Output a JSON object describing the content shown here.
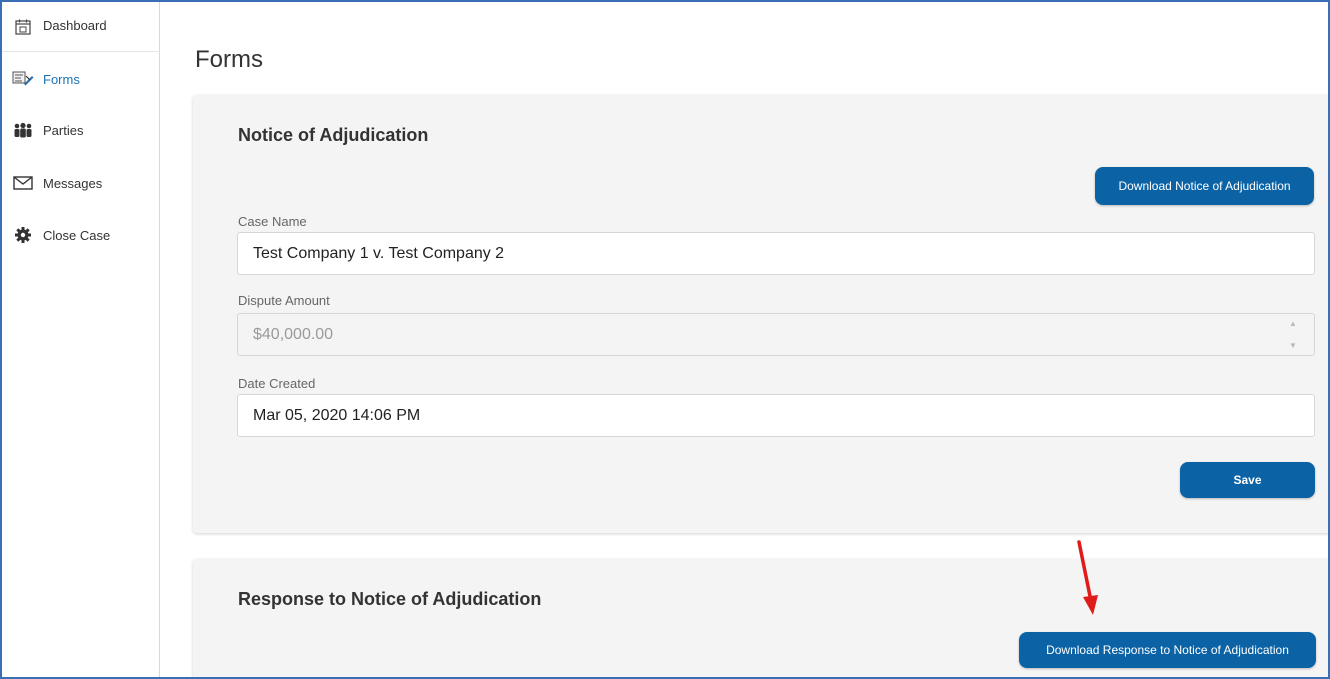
{
  "sidebar": {
    "items": [
      {
        "label": "Dashboard",
        "icon": "calendar-icon",
        "active": false
      },
      {
        "label": "Forms",
        "icon": "forms-icon",
        "active": true
      },
      {
        "label": "Parties",
        "icon": "people-icon",
        "active": false
      },
      {
        "label": "Messages",
        "icon": "envelope-icon",
        "active": false
      },
      {
        "label": "Close Case",
        "icon": "gear-icon",
        "active": false
      }
    ]
  },
  "main": {
    "title": "Forms",
    "notice": {
      "title": "Notice of Adjudication",
      "download_label": "Download Notice of Adjudication",
      "case_name_label": "Case Name",
      "case_name_value": "Test Company 1 v. Test Company 2",
      "dispute_amount_label": "Dispute Amount",
      "dispute_amount_value": "$40,000.00",
      "date_created_label": "Date Created",
      "date_created_value": "Mar 05, 2020 14:06 PM",
      "save_label": "Save"
    },
    "response": {
      "title": "Response to Notice of Adjudication",
      "download_label": "Download Response to Notice of Adjudication"
    }
  },
  "colors": {
    "accent": "#0b63a6",
    "active_nav": "#1b73b3",
    "annotation_arrow": "#e01b1b",
    "frame_border": "#3a6fb5"
  }
}
